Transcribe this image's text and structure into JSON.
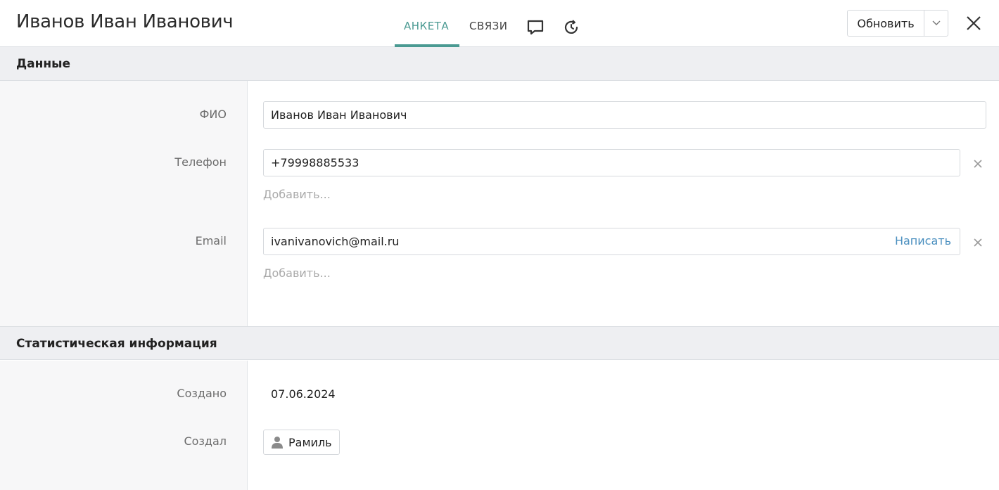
{
  "header": {
    "title": "Иванов Иван Иванович",
    "tabs": [
      {
        "label": "АНКЕТА",
        "active": true
      },
      {
        "label": "СВЯЗИ",
        "active": false
      }
    ],
    "icons": [
      "comment-icon",
      "history-icon",
      "chevron-down-icon",
      "close-icon"
    ],
    "refresh_label": "Обновить"
  },
  "data_section": {
    "title": "Данные",
    "fio_label": "ФИО",
    "fio_value": "Иванов Иван Иванович",
    "phone_label": "Телефон",
    "phone_value": "+79998885533",
    "phone_add": "Добавить...",
    "email_label": "Email",
    "email_value": "ivanivanovich@mail.ru",
    "email_write": "Написать",
    "email_add": "Добавить..."
  },
  "stats_section": {
    "title": "Статистическая информация",
    "created_label": "Создано",
    "created_value": "07.06.2024",
    "creator_label": "Создал",
    "creator_value": "Рамиль",
    "creator_icon": "user-icon"
  },
  "colors": {
    "accent": "#4a9a92",
    "link": "#4a8fbf",
    "section_bg": "#eeeff2"
  }
}
